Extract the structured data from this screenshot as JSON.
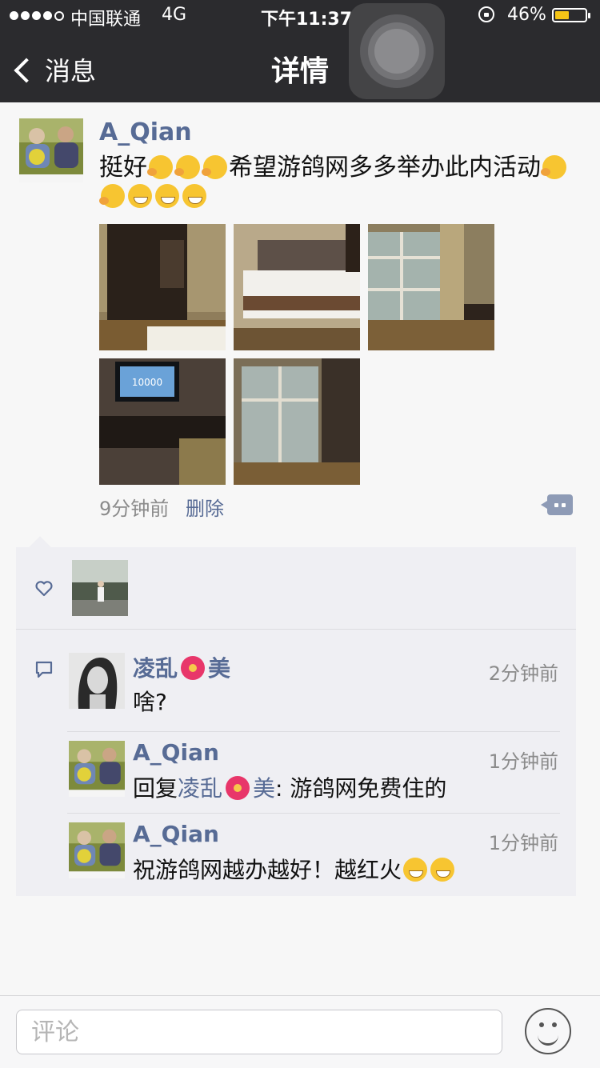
{
  "status": {
    "carrier": "中国联通",
    "network": "4G",
    "time": "下午11:37",
    "battery": "46%",
    "battery_level": 0.46
  },
  "nav": {
    "back_label": "消息",
    "title": "详情"
  },
  "post": {
    "author": "A_Qian",
    "text_part1": "挺好",
    "text_part2": "希望游鸽网多多举办此内活动",
    "photo_tv_text": "10000",
    "time": "9分钟前",
    "delete_label": "删除"
  },
  "comments": [
    {
      "name": "凌乱",
      "name_suffix": "美",
      "time": "2分钟前",
      "text": "啥?"
    },
    {
      "name": "A_Qian",
      "time": "1分钟前",
      "reply_prefix": "回复",
      "reply_to": "凌乱",
      "reply_to_suffix": "美",
      "text": ": 游鸽网免费住的"
    },
    {
      "name": "A_Qian",
      "time": "1分钟前",
      "text": "祝游鸽网越办越好！越红火"
    }
  ],
  "input": {
    "placeholder": "评论"
  },
  "colors": {
    "link": "#576b95",
    "nav_bg": "#2b2b2e",
    "panel_bg": "#efeff3"
  }
}
